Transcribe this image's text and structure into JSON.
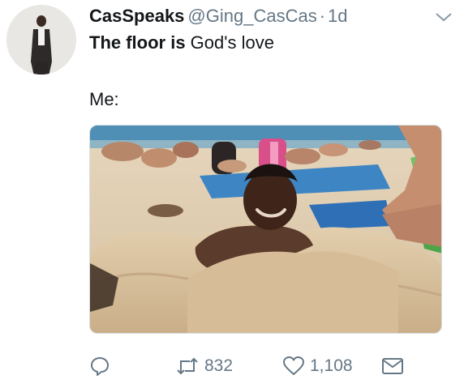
{
  "tweet": {
    "display_name": "CasSpeaks",
    "handle": "@Ging_CasCas",
    "separator": "·",
    "time": "1d",
    "text_bold_1": "The floor is",
    "text_normal": " God's love",
    "text_line_2": "Me:"
  },
  "actions": {
    "reply_icon": "reply-icon",
    "retweet_icon": "retweet-icon",
    "retweet_count": "832",
    "like_icon": "heart-icon",
    "like_count": "1,108",
    "dm_icon": "envelope-icon"
  },
  "colors": {
    "text": "#14171a",
    "muted": "#657786"
  }
}
